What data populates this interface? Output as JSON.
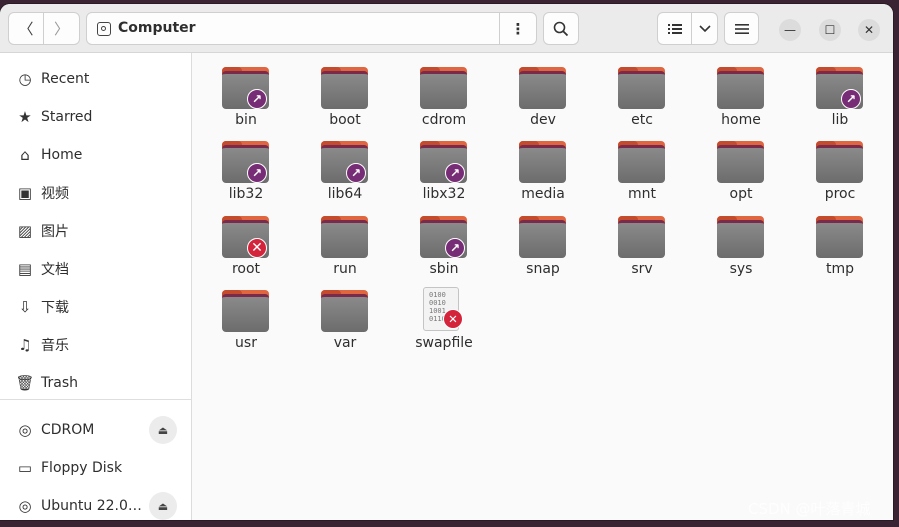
{
  "header": {
    "path": "Computer",
    "back_icon": "chevron-left",
    "forward_icon": "chevron-right",
    "path_menu_icon": "vertical-dots",
    "search_icon": "magnifier",
    "view_icon": "list-view",
    "view_dropdown_icon": "chevron-down",
    "menu_icon": "hamburger",
    "window_controls": {
      "minimize": "—",
      "maximize": "☐",
      "close": "✕"
    }
  },
  "sidebar": {
    "places": [
      {
        "label": "Recent",
        "icon": "clock"
      },
      {
        "label": "Starred",
        "icon": "star"
      },
      {
        "label": "Home",
        "icon": "home"
      },
      {
        "label": "视频",
        "icon": "video"
      },
      {
        "label": "图片",
        "icon": "image"
      },
      {
        "label": "文档",
        "icon": "document"
      },
      {
        "label": "下载",
        "icon": "download"
      },
      {
        "label": "音乐",
        "icon": "music"
      },
      {
        "label": "Trash",
        "icon": "trash"
      }
    ],
    "devices": [
      {
        "label": "CDROM",
        "icon": "disc",
        "eject": true
      },
      {
        "label": "Floppy Disk",
        "icon": "drive",
        "eject": false
      },
      {
        "label": "Ubuntu 22.0…",
        "icon": "disc",
        "eject": true
      }
    ]
  },
  "files": [
    {
      "name": "bin",
      "type": "folder",
      "badge": "link"
    },
    {
      "name": "boot",
      "type": "folder",
      "badge": ""
    },
    {
      "name": "cdrom",
      "type": "folder",
      "badge": ""
    },
    {
      "name": "dev",
      "type": "folder",
      "badge": ""
    },
    {
      "name": "etc",
      "type": "folder",
      "badge": ""
    },
    {
      "name": "home",
      "type": "folder",
      "badge": ""
    },
    {
      "name": "lib",
      "type": "folder",
      "badge": "link"
    },
    {
      "name": "lib32",
      "type": "folder",
      "badge": "link"
    },
    {
      "name": "lib64",
      "type": "folder",
      "badge": "link"
    },
    {
      "name": "libx32",
      "type": "folder",
      "badge": "link"
    },
    {
      "name": "media",
      "type": "folder",
      "badge": ""
    },
    {
      "name": "mnt",
      "type": "folder",
      "badge": ""
    },
    {
      "name": "opt",
      "type": "folder",
      "badge": ""
    },
    {
      "name": "proc",
      "type": "folder",
      "badge": ""
    },
    {
      "name": "root",
      "type": "folder",
      "badge": "denied"
    },
    {
      "name": "run",
      "type": "folder",
      "badge": ""
    },
    {
      "name": "sbin",
      "type": "folder",
      "badge": "link"
    },
    {
      "name": "snap",
      "type": "folder",
      "badge": ""
    },
    {
      "name": "srv",
      "type": "folder",
      "badge": ""
    },
    {
      "name": "sys",
      "type": "folder",
      "badge": ""
    },
    {
      "name": "tmp",
      "type": "folder",
      "badge": ""
    },
    {
      "name": "usr",
      "type": "folder",
      "badge": ""
    },
    {
      "name": "var",
      "type": "folder",
      "badge": ""
    },
    {
      "name": "swapfile",
      "type": "file",
      "badge": "denied",
      "preview": [
        "0100",
        "0010",
        "1001",
        "0110"
      ]
    }
  ],
  "watermark": "CSDN @叶落青城"
}
